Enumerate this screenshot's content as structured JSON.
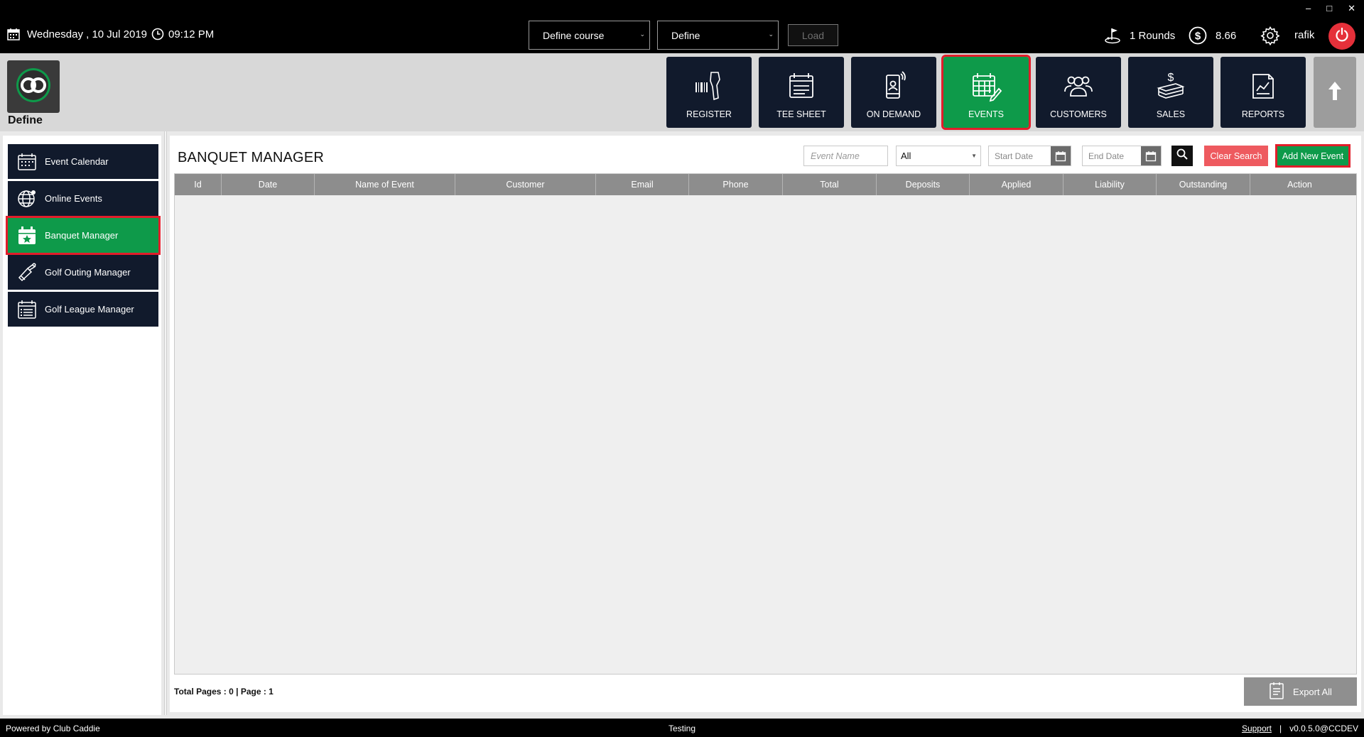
{
  "topbar": {
    "date": "Wednesday ,  10 Jul 2019",
    "time": "09:12 PM",
    "course_select": "Define course",
    "define_select": "Define",
    "load_label": "Load",
    "rounds": "1 Rounds",
    "balance": "8.66",
    "user": "rafik",
    "window_controls": [
      "–",
      "□",
      "✕"
    ]
  },
  "header": {
    "logo_label": "Define",
    "nav": [
      {
        "label": "REGISTER",
        "icon": "barcode-scanner-icon"
      },
      {
        "label": "TEE SHEET",
        "icon": "tee-sheet-icon"
      },
      {
        "label": "ON DEMAND",
        "icon": "mobile-phone-icon"
      },
      {
        "label": "EVENTS",
        "icon": "events-calendar-icon",
        "active": true
      },
      {
        "label": "CUSTOMERS",
        "icon": "customers-icon"
      },
      {
        "label": "SALES",
        "icon": "sales-icon"
      },
      {
        "label": "REPORTS",
        "icon": "reports-icon"
      }
    ]
  },
  "sidebar": {
    "items": [
      {
        "label": "Event Calendar",
        "icon": "calendar-icon"
      },
      {
        "label": "Online Events",
        "icon": "globe-icon"
      },
      {
        "label": "Banquet Manager",
        "icon": "banquet-calendar-icon",
        "active": true
      },
      {
        "label": "Golf Outing Manager",
        "icon": "golf-bag-icon"
      },
      {
        "label": "Golf League Manager",
        "icon": "list-calendar-icon"
      }
    ]
  },
  "main": {
    "title": "BANQUET MANAGER",
    "filters": {
      "event_name_placeholder": "Event Name",
      "status_selected": "All",
      "start_date_placeholder": "Start Date",
      "end_date_placeholder": "End Date",
      "clear_label": "Clear Search",
      "add_label": "Add New Event"
    },
    "table": {
      "columns": [
        "Id",
        "Date",
        "Name of Event",
        "Customer",
        "Email",
        "Phone",
        "Total",
        "Deposits",
        "Applied",
        "Liability",
        "Outstanding",
        "Action"
      ],
      "rows": []
    },
    "pager": "Total Pages : 0 | Page : 1",
    "export_label": "Export All"
  },
  "footer": {
    "powered_by": "Powered by Club Caddie",
    "environment": "Testing",
    "support": "Support",
    "separator": "|",
    "version": "v0.0.5.0@CCDEV"
  },
  "colors": {
    "accent_green": "#0e9a4a",
    "highlight_red": "#e21d2a",
    "nav_dark": "#111a2c",
    "clear_red": "#ee5a5f"
  }
}
